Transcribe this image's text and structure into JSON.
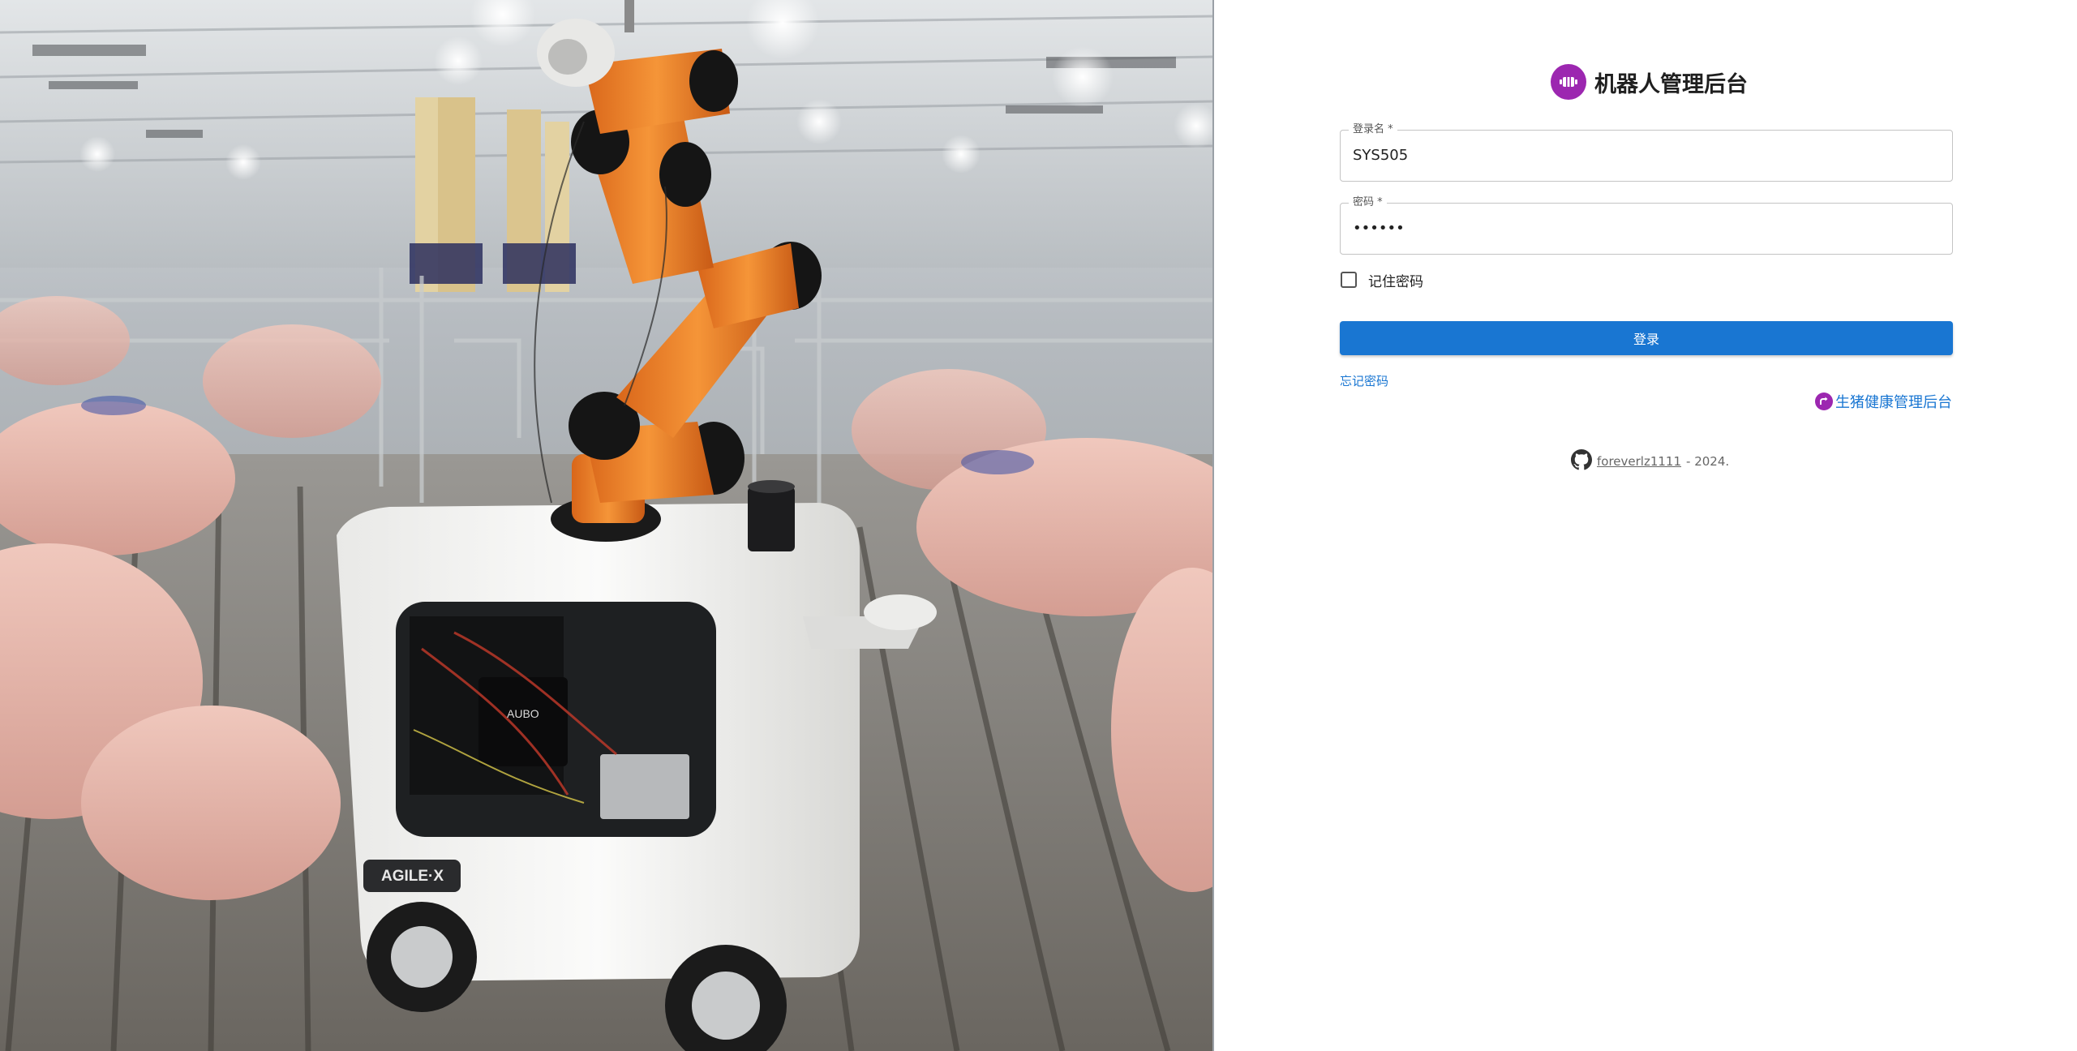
{
  "hero": {
    "brand_plate": "AGILE·X",
    "board_label": "AUBO"
  },
  "brand": {
    "logo_icon": "robot-badge-icon",
    "title": "机器人管理后台",
    "accent_color": "#9c27b0"
  },
  "form": {
    "username": {
      "label": "登录名 *",
      "value": "SYS505"
    },
    "password": {
      "label": "密码 *",
      "value": "••••••"
    },
    "remember": {
      "label": "记住密码",
      "checked": false
    },
    "submit_label": "登录",
    "forgot_label": "忘记密码",
    "primary_color": "#1976d2"
  },
  "pig_link": {
    "icon": "redirect-icon",
    "label": "生猪健康管理后台"
  },
  "footer": {
    "icon": "github-icon",
    "author": "foreverlz1111",
    "suffix": "- 2024."
  }
}
